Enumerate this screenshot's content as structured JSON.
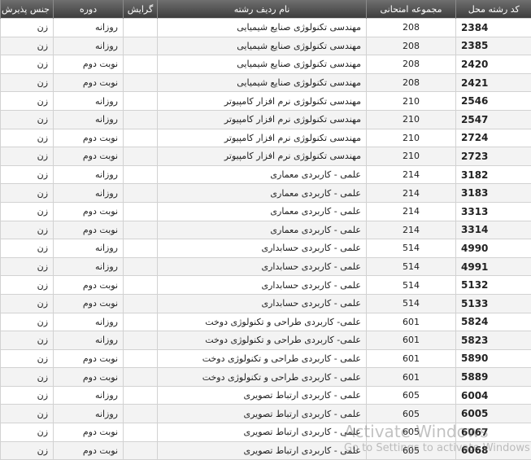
{
  "table": {
    "headers": {
      "code": "کد رشته محل",
      "exam_group": "مجموعه امتحانی",
      "field_name": "نام ردیف رشته",
      "track": "گرایش",
      "shift": "دوره",
      "gender": "جنس پذیرش"
    },
    "rows": [
      {
        "code": "2384",
        "exam_group": "208",
        "field_name": "مهندسی تکنولوژی صنایع شیمیایی",
        "track": "",
        "shift": "روزانه",
        "gender": "زن"
      },
      {
        "code": "2385",
        "exam_group": "208",
        "field_name": "مهندسی تکنولوژی صنایع شیمیایی",
        "track": "",
        "shift": "روزانه",
        "gender": "زن"
      },
      {
        "code": "2420",
        "exam_group": "208",
        "field_name": "مهندسی تکنولوژی صنایع شیمیایی",
        "track": "",
        "shift": "نوبت دوم",
        "gender": "زن"
      },
      {
        "code": "2421",
        "exam_group": "208",
        "field_name": "مهندسی تکنولوژی صنایع شیمیایی",
        "track": "",
        "shift": "نوبت دوم",
        "gender": "زن"
      },
      {
        "code": "2546",
        "exam_group": "210",
        "field_name": "مهندسی تکنولوژی نرم افزار کامپیوتر",
        "track": "",
        "shift": "روزانه",
        "gender": "زن"
      },
      {
        "code": "2547",
        "exam_group": "210",
        "field_name": "مهندسی تکنولوژی نرم افزار کامپیوتر",
        "track": "",
        "shift": "روزانه",
        "gender": "زن"
      },
      {
        "code": "2724",
        "exam_group": "210",
        "field_name": "مهندسی تکنولوژی نرم افزار کامپیوتر",
        "track": "",
        "shift": "نوبت دوم",
        "gender": "زن"
      },
      {
        "code": "2723",
        "exam_group": "210",
        "field_name": "مهندسی تکنولوژی نرم افزار کامپیوتر",
        "track": "",
        "shift": "نوبت دوم",
        "gender": "زن"
      },
      {
        "code": "3182",
        "exam_group": "214",
        "field_name": "علمی - کاربردی معماری",
        "track": "",
        "shift": "روزانه",
        "gender": "زن"
      },
      {
        "code": "3183",
        "exam_group": "214",
        "field_name": "علمی - کاربردی معماری",
        "track": "",
        "shift": "روزانه",
        "gender": "زن"
      },
      {
        "code": "3313",
        "exam_group": "214",
        "field_name": "علمی - کاربردی معماری",
        "track": "",
        "shift": "نوبت دوم",
        "gender": "زن"
      },
      {
        "code": "3314",
        "exam_group": "214",
        "field_name": "علمی - کاربردی معماری",
        "track": "",
        "shift": "نوبت دوم",
        "gender": "زن"
      },
      {
        "code": "4990",
        "exam_group": "514",
        "field_name": "علمی - کاربردی حسابداری",
        "track": "",
        "shift": "روزانه",
        "gender": "زن"
      },
      {
        "code": "4991",
        "exam_group": "514",
        "field_name": "علمی - کاربردی حسابداری",
        "track": "",
        "shift": "روزانه",
        "gender": "زن"
      },
      {
        "code": "5132",
        "exam_group": "514",
        "field_name": "علمی - کاربردی حسابداری",
        "track": "",
        "shift": "نوبت دوم",
        "gender": "زن"
      },
      {
        "code": "5133",
        "exam_group": "514",
        "field_name": "علمی - کاربردی حسابداری",
        "track": "",
        "shift": "نوبت دوم",
        "gender": "زن"
      },
      {
        "code": "5824",
        "exam_group": "601",
        "field_name": "علمی- کاربردی طراحی و تکنولوژی دوخت",
        "track": "",
        "shift": "روزانه",
        "gender": "زن"
      },
      {
        "code": "5823",
        "exam_group": "601",
        "field_name": "علمی- کاربردی طراحی و تکنولوژی دوخت",
        "track": "",
        "shift": "روزانه",
        "gender": "زن"
      },
      {
        "code": "5890",
        "exam_group": "601",
        "field_name": "علمی - کاربردی طراحی و تکنولوژی دوخت",
        "track": "",
        "shift": "نوبت دوم",
        "gender": "زن"
      },
      {
        "code": "5889",
        "exam_group": "601",
        "field_name": "علمی - کاربردی طراحی و تکنولوژی دوخت",
        "track": "",
        "shift": "نوبت دوم",
        "gender": "زن"
      },
      {
        "code": "6004",
        "exam_group": "605",
        "field_name": "علمی - کاربردی ارتباط تصویری",
        "track": "",
        "shift": "روزانه",
        "gender": "زن"
      },
      {
        "code": "6005",
        "exam_group": "605",
        "field_name": "علمی - کاربردی ارتباط تصویری",
        "track": "",
        "shift": "روزانه",
        "gender": "زن"
      },
      {
        "code": "6067",
        "exam_group": "605",
        "field_name": "علمی - کاربردی ارتباط تصویری",
        "track": "",
        "shift": "نوبت دوم",
        "gender": "زن"
      },
      {
        "code": "6068",
        "exam_group": "605",
        "field_name": "علمی - کاربردی ارتباط تصویری",
        "track": "",
        "shift": "نوبت دوم",
        "gender": "زن"
      }
    ]
  },
  "watermark": {
    "title": "Activate Windows",
    "subtitle": "Go to Settings to activate Windows."
  }
}
